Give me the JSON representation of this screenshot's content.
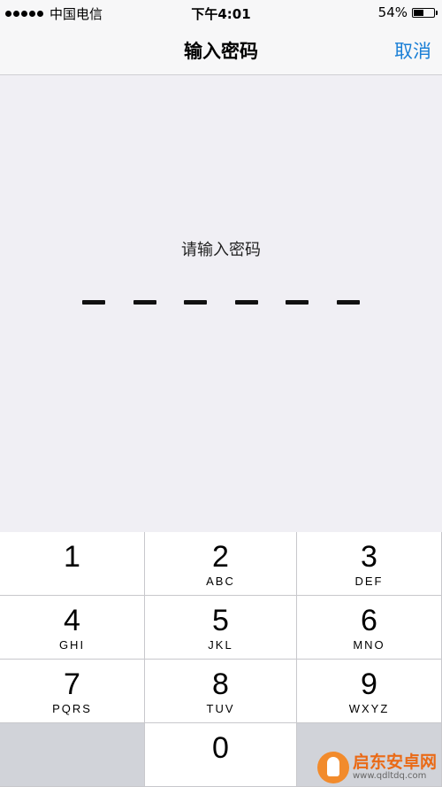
{
  "status": {
    "carrier": "中国电信",
    "time": "下午4:01",
    "battery_text": "54%",
    "battery_level": 0.54
  },
  "nav": {
    "title": "输入密码",
    "cancel_label": "取消"
  },
  "prompt": "请输入密码",
  "pin_length": 6,
  "keys": [
    {
      "digit": "1",
      "letters": ""
    },
    {
      "digit": "2",
      "letters": "ABC"
    },
    {
      "digit": "3",
      "letters": "DEF"
    },
    {
      "digit": "4",
      "letters": "GHI"
    },
    {
      "digit": "5",
      "letters": "JKL"
    },
    {
      "digit": "6",
      "letters": "MNO"
    },
    {
      "digit": "7",
      "letters": "PQRS"
    },
    {
      "digit": "8",
      "letters": "TUV"
    },
    {
      "digit": "9",
      "letters": "WXYZ"
    },
    {
      "digit": "0",
      "letters": ""
    }
  ],
  "watermark": {
    "title": "启东安卓网",
    "url": "www.qdltdq.com"
  },
  "colors": {
    "accent": "#1a7fd6",
    "background": "#f0eff4",
    "keypad_gray": "#d1d3d9"
  }
}
